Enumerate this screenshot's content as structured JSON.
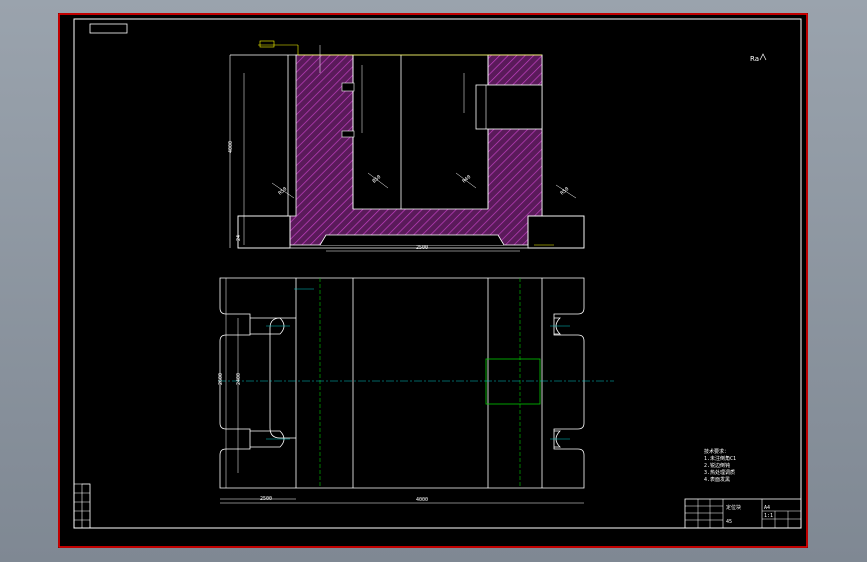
{
  "drawing": {
    "corner_mark": "Ra",
    "dimensions_top_view": [
      "4000",
      "R50",
      "Ø50",
      "R40",
      "R50",
      "24",
      "2500"
    ],
    "dimensions_plan_view": [
      "2500",
      "4000",
      "2600",
      "2400"
    ],
    "technical_notes": [
      "技术要求：",
      "1.未注倒角C1",
      "2.锐边倒钝",
      "3.热处理调质",
      "4.表面发黑"
    ],
    "title_block": {
      "part_name": "定位块",
      "drawing_no": "A4",
      "scale": "1:1",
      "material": "45"
    },
    "revision_rows": [
      "",
      "",
      "",
      "",
      ""
    ]
  },
  "colors": {
    "sheet_background": "#000000",
    "outer_border": "#ff0000",
    "frame": "#ffffff",
    "section_hatch": "#8a2be2",
    "section_fill": "#5a1a5a",
    "centerline": "#00c8c8",
    "hidden_line": "#00c800",
    "leader": "#ffff00"
  }
}
